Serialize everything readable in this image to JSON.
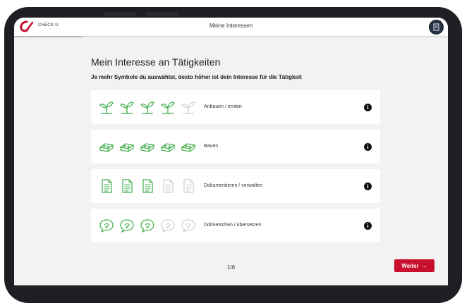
{
  "app": {
    "brand": "CHECK-U",
    "title": "Meine Interessen"
  },
  "progress": {
    "fraction": 0.16
  },
  "main": {
    "heading": "Mein Interesse an Tätigkeiten",
    "subheading": "Je mehr Symbole du auswählst, desto höher ist dein Interesse für die Tätigkeit"
  },
  "activities": [
    {
      "label": "Anbauen / ernten",
      "icon": "sprout-icon",
      "selected": 4,
      "total": 5,
      "info_glyph": "i"
    },
    {
      "label": "Bauen",
      "icon": "brick-icon",
      "selected": 5,
      "total": 5,
      "info_glyph": "i"
    },
    {
      "label": "Dokumentieren / verwalten",
      "icon": "document-icon",
      "selected": 3,
      "total": 5,
      "info_glyph": "i"
    },
    {
      "label": "Dolmetschen / übersetzen",
      "icon": "speech-bubble-icon",
      "selected": 3,
      "total": 5,
      "info_glyph": "i"
    }
  ],
  "pager": {
    "text": "1/6"
  },
  "footer": {
    "next_label": "Weiter",
    "next_arrow": "→"
  },
  "colors": {
    "accent": "#c8102e",
    "icon_active": "#3fae49",
    "icon_inactive": "#cfcfcf"
  }
}
